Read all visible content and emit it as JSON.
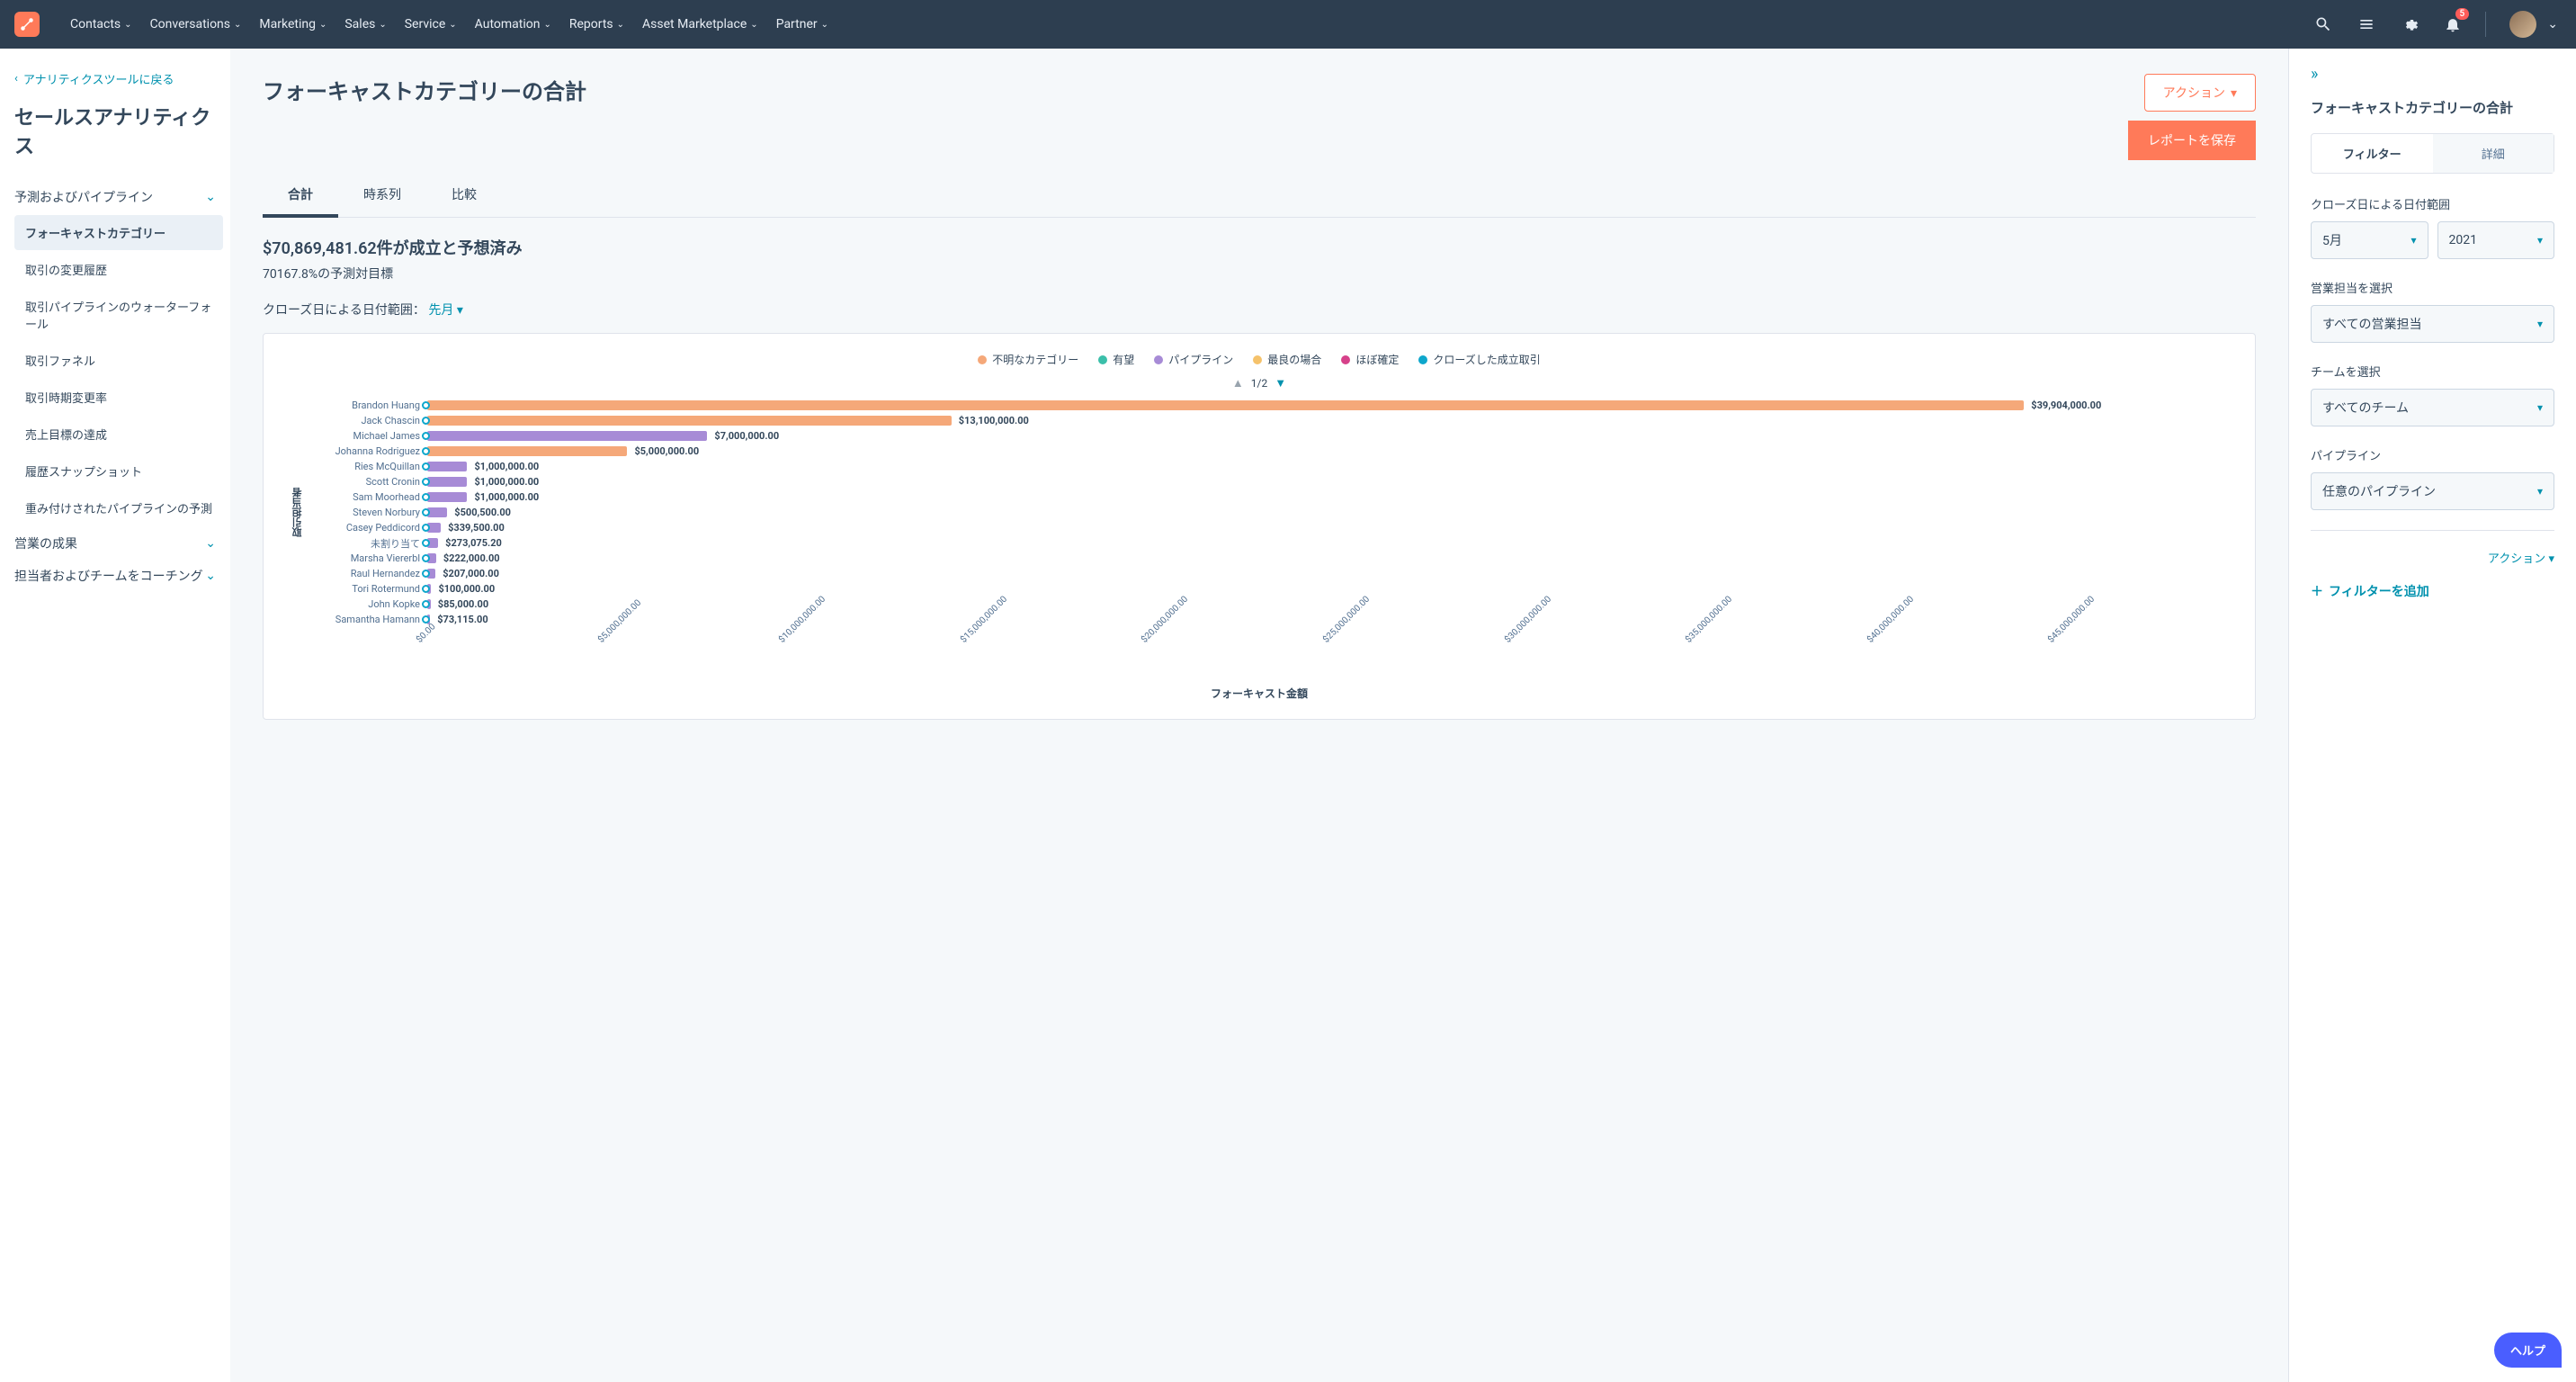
{
  "nav": {
    "items": [
      "Contacts",
      "Conversations",
      "Marketing",
      "Sales",
      "Service",
      "Automation",
      "Reports",
      "Asset Marketplace",
      "Partner"
    ],
    "badge": "5"
  },
  "sidebar": {
    "back": "アナリティクスツールに戻る",
    "title": "セールスアナリティクス",
    "section1": "予測およびパイプライン",
    "items": [
      "フォーキャストカテゴリー",
      "取引の変更履歴",
      "取引パイプラインのウォーターフォール",
      "取引ファネル",
      "取引時期変更率",
      "売上目標の達成",
      "履歴スナップショット",
      "重み付けされたパイプラインの予測"
    ],
    "section2": "営業の成果",
    "section3": "担当者およびチームをコーチング"
  },
  "page": {
    "title": "フォーキャストカテゴリーの合計",
    "actions": "アクション",
    "save": "レポートを保存",
    "tabs": [
      "合計",
      "時系列",
      "比較"
    ],
    "metric": "$70,869,481.62件が成立と予想済み",
    "sub_metric": "70167.8%の予測対目標",
    "date_label": "クローズ日による日付範囲：",
    "date_value": "先月"
  },
  "legend": [
    {
      "label": "不明なカテゴリー",
      "color": "#f5a879"
    },
    {
      "label": "有望",
      "color": "#3bbfaa"
    },
    {
      "label": "パイプライン",
      "color": "#a78bd6"
    },
    {
      "label": "最良の場合",
      "color": "#f5c26b"
    },
    {
      "label": "ほぼ確定",
      "color": "#d6418a"
    },
    {
      "label": "クローズした成立取引",
      "color": "#0ea7cc"
    }
  ],
  "pager": "1/2",
  "chart_data": {
    "type": "bar",
    "title": "フォーキャストカテゴリーの合計",
    "xlabel": "フォーキャスト金額",
    "ylabel": "取引担当者",
    "xlim": [
      0,
      45000000
    ],
    "x_ticks": [
      "$0.00",
      "$5,000,000.00",
      "$10,000,000.00",
      "$15,000,000.00",
      "$20,000,000.00",
      "$25,000,000.00",
      "$30,000,000.00",
      "$35,000,000.00",
      "$40,000,000.00",
      "$45,000,000.00"
    ],
    "categories": [
      "Brandon Huang",
      "Jack Chascin",
      "Michael James",
      "Johanna Rodriguez",
      "Ries McQuillan",
      "Scott Cronin",
      "Sam Moorhead",
      "Steven Norbury",
      "Casey Peddicord",
      "未割り当て",
      "Marsha Viererbl",
      "Raul Hernandez",
      "Tori Rotermund",
      "John Kopke",
      "Samantha Hamann"
    ],
    "values": [
      39904000.0,
      13100000.0,
      7000000.0,
      5000000.0,
      1000000.0,
      1000000.0,
      1000000.0,
      500500.0,
      339500.0,
      273075.2,
      222000.0,
      207000.0,
      100000.0,
      85000.0,
      73115.0
    ],
    "display_values": [
      "$39,904,000.00",
      "$13,100,000.00",
      "$7,000,000.00",
      "$5,000,000.00",
      "$1,000,000.00",
      "$1,000,000.00",
      "$1,000,000.00",
      "$500,500.00",
      "$339,500.00",
      "$273,075.20",
      "$222,000.00",
      "$207,000.00",
      "$100,000.00",
      "$85,000.00",
      "$73,115.00"
    ],
    "bar_colors": [
      "#f5a879",
      "#f5a879",
      "#a78bd6",
      "#f5a879",
      "#a78bd6",
      "#a78bd6",
      "#a78bd6",
      "#a78bd6",
      "#a78bd6",
      "#a78bd6",
      "#a78bd6",
      "#a78bd6",
      "#a78bd6",
      "#a78bd6",
      "#a78bd6"
    ]
  },
  "right": {
    "title": "フォーキャストカテゴリーの合計",
    "tabs": [
      "フィルター",
      "詳細"
    ],
    "f1_label": "クローズ日による日付範囲",
    "f1_month": "5月",
    "f1_year": "2021",
    "f2_label": "営業担当を選択",
    "f2_value": "すべての営業担当",
    "f3_label": "チームを選択",
    "f3_value": "すべてのチーム",
    "f4_label": "パイプライン",
    "f4_value": "任意のパイプライン",
    "actions": "アクション",
    "add_filter": "フィルターを追加"
  },
  "help": "ヘルプ"
}
